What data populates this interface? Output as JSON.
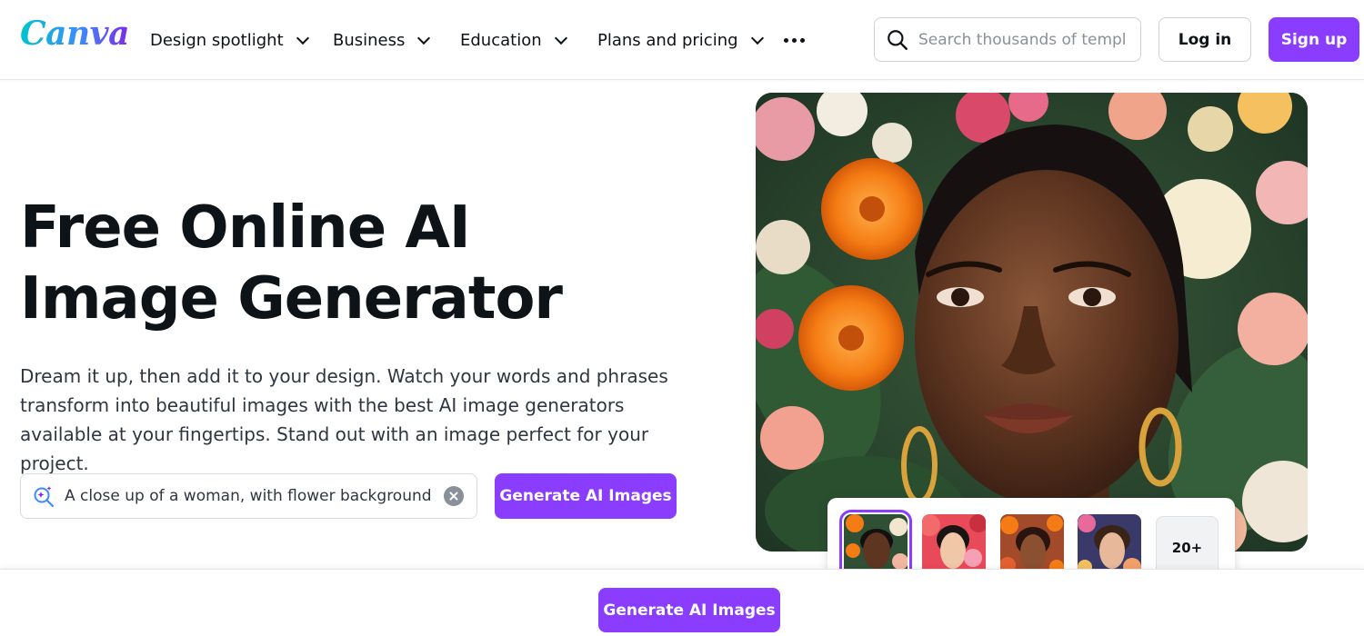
{
  "header": {
    "logo": "Canva",
    "nav": [
      {
        "label": "Design spotlight"
      },
      {
        "label": "Business"
      },
      {
        "label": "Education"
      },
      {
        "label": "Plans and pricing"
      }
    ],
    "search_placeholder": "Search thousands of templates",
    "login_label": "Log in",
    "signup_label": "Sign up"
  },
  "hero": {
    "title": "Free Online AI Image Generator",
    "description": "Dream it up, then add it to your design. Watch your words and phrases transform into beautiful images with the best AI image generators available at your fingertips. Stand out with an image perfect for your project.",
    "prompt_value": "A close up of a woman, with flower background",
    "generate_label": "Generate AI Images"
  },
  "thumbnails": {
    "more_label": "20+"
  },
  "bottom_bar": {
    "generate_label": "Generate AI Images"
  },
  "colors": {
    "brand_purple": "#8b3dff",
    "text_dark": "#0e1318",
    "logo_gradient_start": "#00c4cc",
    "logo_gradient_end": "#7d2ae8"
  }
}
